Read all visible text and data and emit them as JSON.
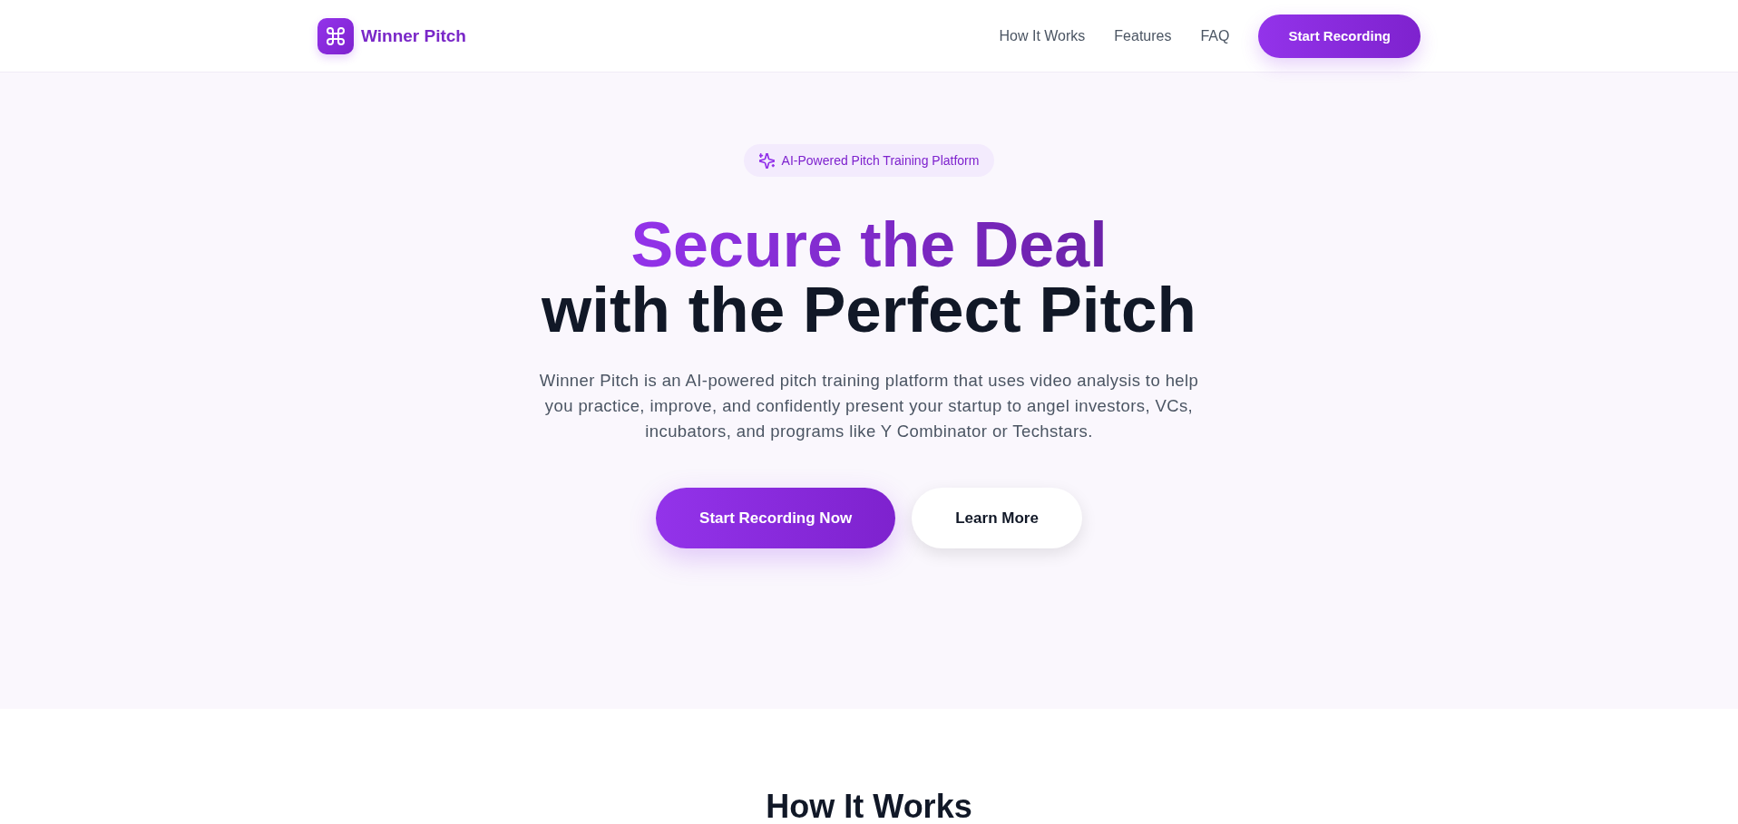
{
  "header": {
    "logo": {
      "name": "Winner Pitch"
    },
    "nav_links": [
      "How It Works",
      "Features",
      "FAQ"
    ],
    "cta_button": "Start Recording"
  },
  "hero": {
    "badge": "AI-Powered Pitch Training Platform",
    "headline": {
      "line_1": "Secure the Deal",
      "line_2": "with the Perfect Pitch"
    },
    "description": "Winner Pitch is an AI-powered pitch training platform that uses video analysis to help you practice, improve, and confidently present your startup to angel investors, VCs, incubators, and programs like Y Combinator or Techstars.",
    "buttons": [
      {
        "label": "Start Recording Now",
        "kind": "primary"
      },
      {
        "label": "Learn More",
        "kind": "secondary"
      }
    ]
  },
  "how_it_works": {
    "title": "How It Works"
  }
}
